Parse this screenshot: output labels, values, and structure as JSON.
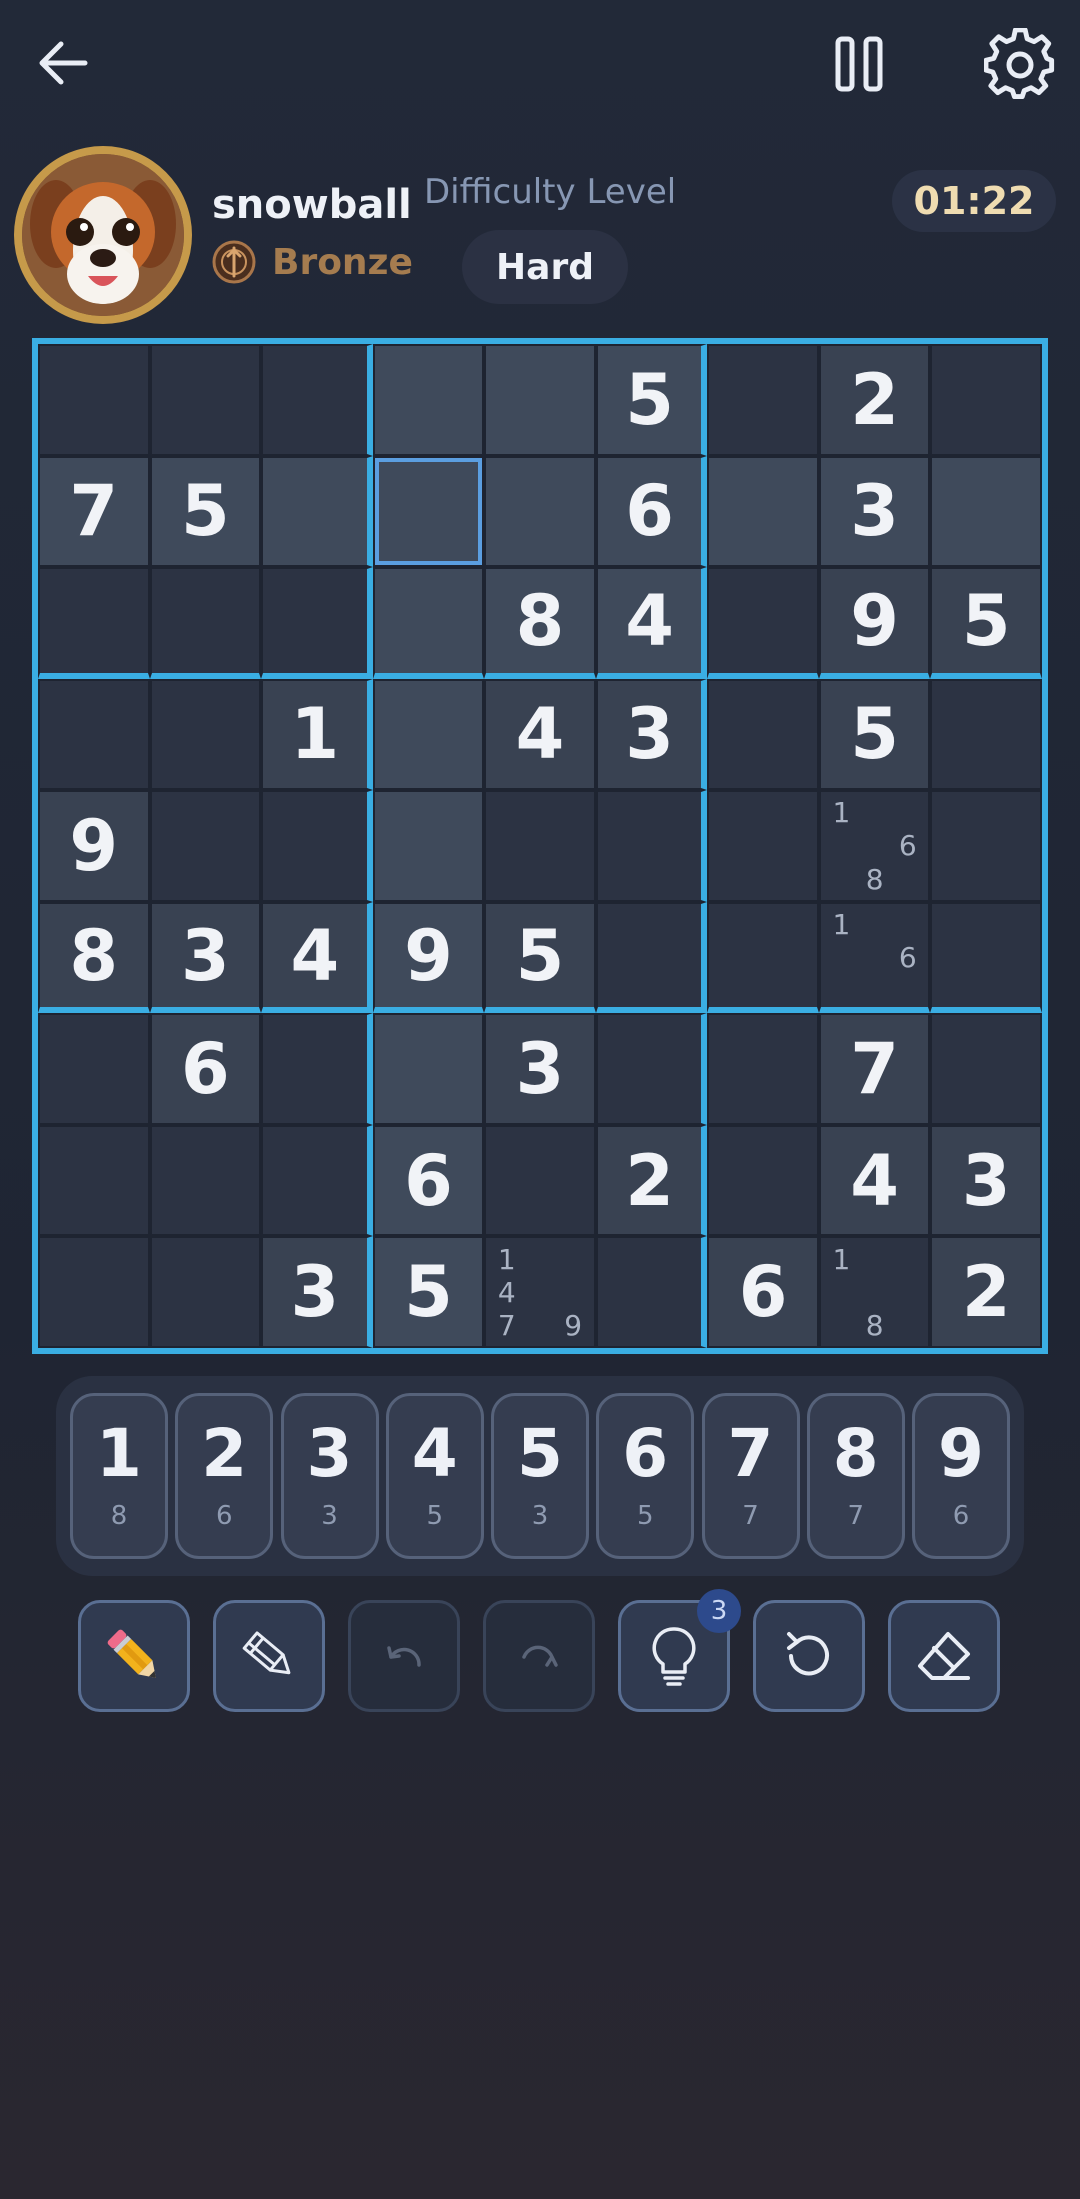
{
  "header": {
    "back_icon": "arrow-left-icon",
    "pause_icon": "pause-icon",
    "settings_icon": "gear-icon"
  },
  "player": {
    "name": "snowball",
    "rank": "Bronze",
    "rank_icon": "bronze-rank-medal-icon",
    "avatar": "puppy-avatar"
  },
  "difficulty": {
    "label": "Difficulty Level",
    "value": "Hard"
  },
  "timer": "01:22",
  "board": {
    "selected": {
      "row": 1,
      "col": 3
    },
    "rows": [
      [
        "",
        "",
        "",
        "",
        "",
        "5",
        "",
        "2",
        ""
      ],
      [
        "7",
        "5",
        "",
        "",
        "",
        "6",
        "",
        "3",
        ""
      ],
      [
        "",
        "",
        "",
        "",
        "8",
        "4",
        "",
        "9",
        "5"
      ],
      [
        "",
        "",
        "1",
        "",
        "4",
        "3",
        "",
        "5",
        ""
      ],
      [
        "9",
        "",
        "",
        "",
        "",
        "",
        "",
        "",
        ""
      ],
      [
        "8",
        "3",
        "4",
        "9",
        "5",
        "",
        "",
        "",
        ""
      ],
      [
        "",
        "6",
        "",
        "",
        "3",
        "",
        "",
        "7",
        ""
      ],
      [
        "",
        "",
        "",
        "6",
        "",
        "2",
        "",
        "4",
        "3"
      ],
      [
        "",
        "",
        "3",
        "5",
        "",
        "",
        "6",
        "",
        "2"
      ]
    ],
    "notes": [
      {
        "row": 4,
        "col": 7,
        "digits": [
          "1",
          "6",
          "8"
        ]
      },
      {
        "row": 5,
        "col": 7,
        "digits": [
          "1",
          "6"
        ]
      },
      {
        "row": 8,
        "col": 4,
        "digits": [
          "1",
          "4",
          "7",
          "9"
        ]
      },
      {
        "row": 8,
        "col": 7,
        "digits": [
          "1",
          "8"
        ]
      }
    ]
  },
  "numpad": [
    {
      "digit": "1",
      "remaining": "8"
    },
    {
      "digit": "2",
      "remaining": "6"
    },
    {
      "digit": "3",
      "remaining": "3"
    },
    {
      "digit": "4",
      "remaining": "5"
    },
    {
      "digit": "5",
      "remaining": "3"
    },
    {
      "digit": "6",
      "remaining": "5"
    },
    {
      "digit": "7",
      "remaining": "7"
    },
    {
      "digit": "8",
      "remaining": "7"
    },
    {
      "digit": "9",
      "remaining": "6"
    }
  ],
  "tools": [
    {
      "name": "pencil-notes",
      "icon": "pencil-icon",
      "enabled": true
    },
    {
      "name": "auto-notes",
      "icon": "outline-pencil-icon",
      "enabled": true
    },
    {
      "name": "undo",
      "icon": "undo-icon",
      "enabled": false
    },
    {
      "name": "redo",
      "icon": "redo-icon",
      "enabled": false
    },
    {
      "name": "hint",
      "icon": "lightbulb-icon",
      "enabled": true,
      "badge": "3"
    },
    {
      "name": "restart",
      "icon": "restart-icon",
      "enabled": true
    },
    {
      "name": "erase",
      "icon": "eraser-icon",
      "enabled": true
    }
  ]
}
